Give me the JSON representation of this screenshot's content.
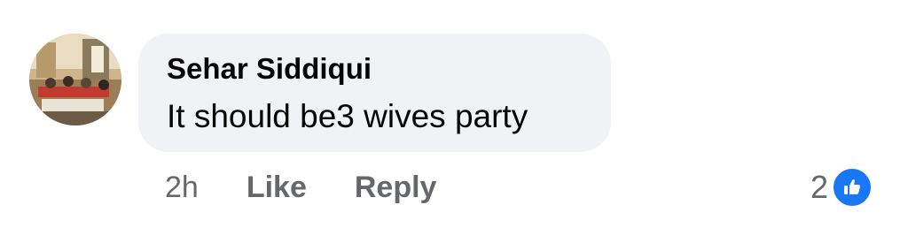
{
  "comment": {
    "author": "Sehar Siddiqui",
    "text": "It should be3 wives party",
    "time": "2h",
    "like_label": "Like",
    "reply_label": "Reply",
    "reaction_count": "2"
  },
  "colors": {
    "bubble": "#f0f2f5",
    "meta_text": "#65676b",
    "like_blue": "#1877f2"
  },
  "icons": {
    "reaction": "thumbs-up-icon"
  }
}
